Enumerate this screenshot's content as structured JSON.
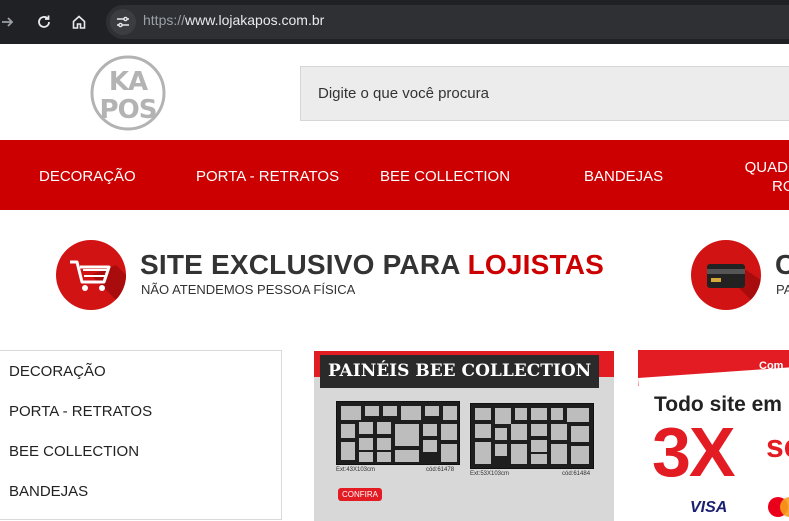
{
  "browser": {
    "url_scheme": "https://",
    "url_host": "www.lojakapos.com.br"
  },
  "header": {
    "logo_text": "KAPOS",
    "search_placeholder": "Digite o que você procura"
  },
  "main_nav": {
    "items": [
      "DECORAÇÃO",
      "PORTA - RETRATOS",
      "BEE COLLECTION",
      "BANDEJAS"
    ],
    "partial_line1": "QUAD",
    "partial_line2": "RO"
  },
  "banner": {
    "title_prefix": "SITE EXCLUSIVO PARA ",
    "title_accent": "LOJISTAS",
    "subtitle": "NÃO ATENDEMOS PESSOA FÍSICA",
    "second_title": "C",
    "second_sub": "PA"
  },
  "sidebar": {
    "items": [
      "DECORAÇÃO",
      "PORTA - RETRATOS",
      "BEE COLLECTION",
      "BANDEJAS"
    ]
  },
  "promo_bee": {
    "title": "PAINÉIS BEE COLLECTION",
    "ext_left": "Ext:43X103cm",
    "code_left": "cód:61478",
    "ext_right": "Ext:53X103cm",
    "code_right": "cód:61484",
    "cta": "CONFIRA"
  },
  "promo_pay": {
    "tag": "Com",
    "line": "Todo site em",
    "big": "3X",
    "big_suffix": "se",
    "visa": "VISA"
  },
  "colors": {
    "brand_red": "#cc0000",
    "browser_dark": "#202124"
  }
}
